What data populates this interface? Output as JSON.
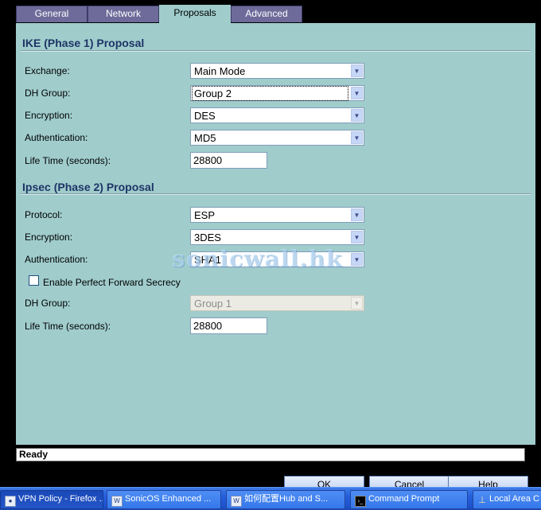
{
  "tabs": [
    "General",
    "Network",
    "Proposals",
    "Advanced"
  ],
  "active_tab": "Proposals",
  "ike": {
    "title": "IKE (Phase 1) Proposal",
    "exchange_label": "Exchange:",
    "exchange_value": "Main Mode",
    "dh_label": "DH Group:",
    "dh_value": "Group 2",
    "encryption_label": "Encryption:",
    "encryption_value": "DES",
    "auth_label": "Authentication:",
    "auth_value": "MD5",
    "life_label": "Life Time (seconds):",
    "life_value": "28800"
  },
  "ipsec": {
    "title": "Ipsec (Phase 2) Proposal",
    "protocol_label": "Protocol:",
    "protocol_value": "ESP",
    "encryption_label": "Encryption:",
    "encryption_value": "3DES",
    "auth_label": "Authentication:",
    "auth_value": "SHA1",
    "pfs_label": "Enable Perfect Forward Secrecy",
    "pfs_checked": false,
    "dh_label": "DH Group:",
    "dh_value": "Group 1",
    "life_label": "Life Time (seconds):",
    "life_value": "28800"
  },
  "watermark": "sonicwall.hk",
  "status": "Ready",
  "buttons": {
    "ok": "OK",
    "cancel": "Cancel",
    "help": "Help"
  },
  "taskbar": [
    "VPN Policy - Firefox ...",
    "SonicOS Enhanced ...",
    "如何配置Hub and S...",
    "Command Prompt",
    "Local Area C"
  ],
  "colors": {
    "panel": "#a0cccc",
    "tab": "#6e6a9a",
    "section_title": "#1f3566",
    "taskbar": "#245edb"
  }
}
